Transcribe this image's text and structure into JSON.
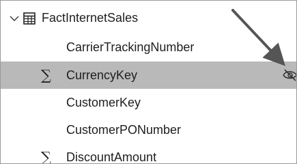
{
  "fields_pane": {
    "table": {
      "name": "FactInternetSales",
      "expand_icon": "chevron-down-icon",
      "table_icon": "table-grid-icon"
    },
    "fields": [
      {
        "name": "CarrierTrackingNumber",
        "sigma": false,
        "selected": false
      },
      {
        "name": "CurrencyKey",
        "sigma": true,
        "selected": true,
        "hidden_icon": "eye-hidden-icon"
      },
      {
        "name": "CustomerKey",
        "sigma": false,
        "selected": false
      },
      {
        "name": "CustomerPONumber",
        "sigma": false,
        "selected": false
      },
      {
        "name": "DiscountAmount",
        "sigma": true,
        "selected": false
      }
    ],
    "sigma_symbol": "∑",
    "colors": {
      "selected_background": "#b9b9b9",
      "annotation_arrow": "#555555"
    }
  }
}
